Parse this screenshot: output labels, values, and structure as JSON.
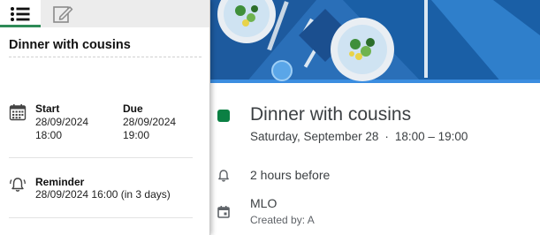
{
  "panel": {
    "tabs": [
      {
        "name": "list-icon",
        "active": true
      },
      {
        "name": "edit-icon",
        "active": false
      }
    ],
    "title": "Dinner with cousins",
    "start": {
      "label": "Start",
      "date": "28/09/2024",
      "time": "18:00"
    },
    "due": {
      "label": "Due",
      "date": "28/09/2024",
      "time": "19:00"
    },
    "reminder": {
      "label": "Reminder",
      "value": "28/09/2024 16:00 (in 3 days)"
    }
  },
  "event": {
    "title": "Dinner with cousins",
    "date": "Saturday, September 28",
    "separator": "·",
    "time_range": "18:00 – 19:00",
    "calendar_color": "#0b8043",
    "reminder": "2 hours before",
    "calendar": "MLO",
    "created_by": "Created by: A"
  },
  "colors": {
    "accent_green": "#2e8b57",
    "banner_blue": "#1a5fa6"
  }
}
